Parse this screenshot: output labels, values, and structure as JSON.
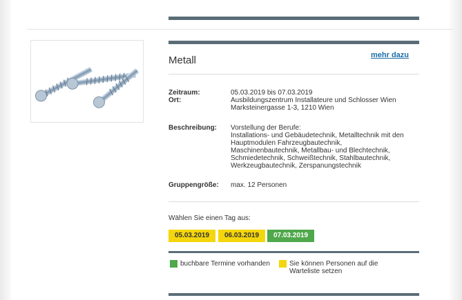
{
  "event": {
    "title": "Metall",
    "more_link": "mehr dazu",
    "details": {
      "zeitraum_label": "Zeitraum:",
      "zeitraum_value": "05.03.2019 bis 07.03.2019",
      "ort_label": "Ort:",
      "ort_lines": [
        "Ausbildungszentrum Installateure und Schlosser Wien",
        "Marksteinergasse 1-3, 1210 Wien"
      ],
      "beschreibung_label": "Beschreibung:",
      "beschreibung_lines": [
        "Vorstellung der Berufe:",
        "Installations- und Gebäudetechnik, Metalltechnik mit den",
        "Hauptmodulen Fahrzeugbautechnik,",
        "Maschinenbautechnik, Metallbau- und Blechtechnik,",
        "Schmiedetechnik, Schweißtechnik, Stahlbautechnik,",
        "Werkzeugbautechnik, Zerspanungstechnik"
      ],
      "gruppengroesse_label": "Gruppengröße:",
      "gruppengroesse_value": "max. 12 Personen"
    },
    "choose_day": "Wählen Sie einen Tag aus:",
    "dates": [
      {
        "label": "05.03.2019",
        "status": "waitlist",
        "color": "#f4d60c"
      },
      {
        "label": "06.03.2019",
        "status": "waitlist",
        "color": "#f4d60c"
      },
      {
        "label": "07.03.2019",
        "status": "available",
        "color": "#4fa84b"
      }
    ],
    "legend": {
      "available": {
        "text": "buchbare Termine vorhanden",
        "color": "#4fa84b"
      },
      "waitlist_lines": [
        "Sie können Personen auf die",
        "Warteliste setzen"
      ],
      "waitlist_color": "#f4d60c"
    }
  },
  "colors": {
    "accent_bar": "#5a6d77",
    "link": "#1a6ea8"
  }
}
